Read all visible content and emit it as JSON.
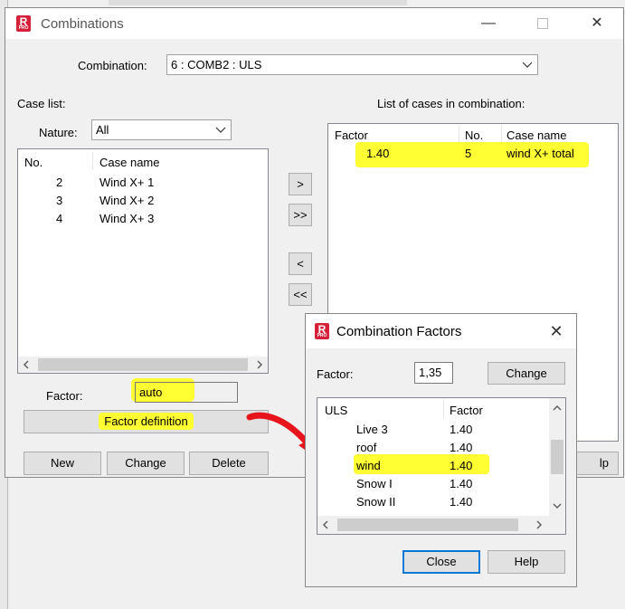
{
  "main": {
    "title": "Combinations",
    "combination_label": "Combination:",
    "combination_value": "6 : COMB2 : ULS",
    "case_list_label": "Case list:",
    "nature_label": "Nature:",
    "nature_value": "All",
    "case_list_headers": {
      "no": "No.",
      "name": "Case name"
    },
    "case_list_rows": [
      {
        "no": "2",
        "name": "Wind X+ 1"
      },
      {
        "no": "3",
        "name": "Wind X+ 2"
      },
      {
        "no": "4",
        "name": "Wind X+ 3"
      }
    ],
    "transfer_buttons": {
      "add": ">",
      "add_all": ">>",
      "remove": "<",
      "remove_all": "<<"
    },
    "combo_list_label": "List of cases in combination:",
    "combo_list_headers": {
      "factor": "Factor",
      "no": "No.",
      "name": "Case name"
    },
    "combo_list_rows": [
      {
        "factor": "1.40",
        "no": "5",
        "name": "wind X+ total"
      }
    ],
    "factor_label": "Factor:",
    "factor_value": "auto",
    "factor_definition_label": "Factor definition",
    "new_label": "New",
    "change_label": "Change",
    "delete_label": "Delete",
    "help_partial": "lp"
  },
  "factors_dialog": {
    "title": "Combination Factors",
    "factor_label": "Factor:",
    "factor_value": "1,35",
    "change_label": "Change",
    "headers": {
      "uls": "ULS",
      "factor": "Factor"
    },
    "rows": [
      {
        "name": "Live 3",
        "factor": "1.40"
      },
      {
        "name": "roof",
        "factor": "1.40"
      },
      {
        "name": "wind",
        "factor": "1.40"
      },
      {
        "name": "Snow I",
        "factor": "1.40"
      },
      {
        "name": "Snow II",
        "factor": "1.40"
      }
    ],
    "close_label": "Close",
    "help_label": "Help"
  },
  "colors": {
    "highlight": "#ffff33",
    "annotation": "#e8141c",
    "accent": "#0078d7"
  }
}
